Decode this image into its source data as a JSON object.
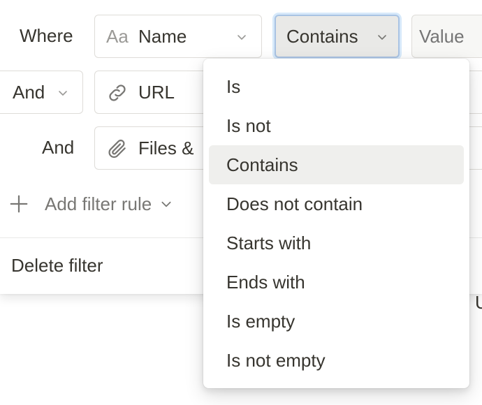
{
  "filter": {
    "rows": [
      {
        "connector": "Where",
        "property_prefix": "Aa",
        "property": "Name",
        "operator": "Contains",
        "value_placeholder": "Value"
      },
      {
        "connector": "And",
        "property": "URL"
      },
      {
        "connector": "And",
        "property": "Files &"
      }
    ],
    "add_rule_label": "Add filter rule",
    "delete_label": "Delete filter",
    "background_glyph": "U"
  },
  "operator_menu": {
    "items": [
      "Is",
      "Is not",
      "Contains",
      "Does not contain",
      "Starts with",
      "Ends with",
      "Is empty",
      "Is not empty"
    ],
    "selected": "Contains"
  },
  "colors": {
    "text": "#37352f",
    "muted": "#787774",
    "border": "#dedcd8",
    "selected_bg": "#efefed",
    "focus_ring": "#a9c3e3"
  }
}
